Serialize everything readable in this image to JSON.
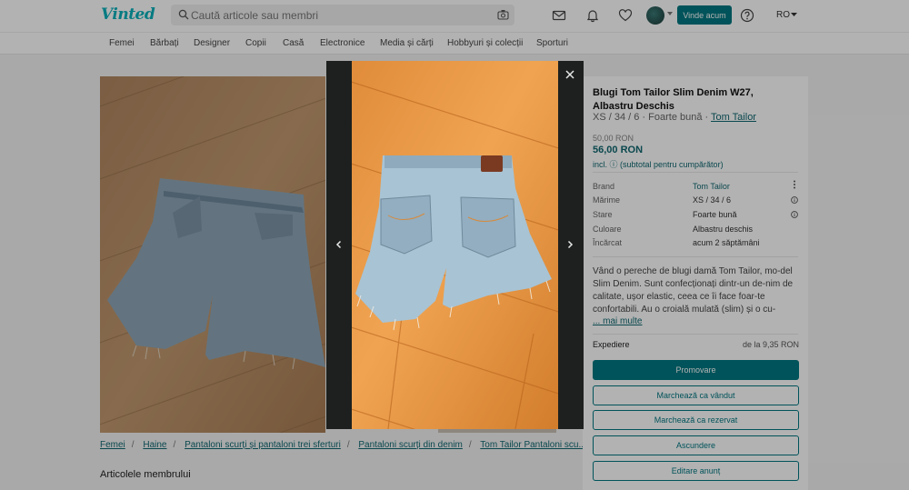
{
  "header": {
    "logo": "Vinted",
    "search_placeholder": "Caută articole sau membri",
    "sell_label": "Vinde acum",
    "lang": "RO"
  },
  "categories": [
    "Femei",
    "Bărbați",
    "Designer",
    "Copii",
    "Casă",
    "Electronice",
    "Media și cărți",
    "Hobbyuri și colecții",
    "Sporturi"
  ],
  "item": {
    "title": "Blugi Tom Tailor Slim Denim W27, Albastru Deschis",
    "sub_sizes": "XS / 34 / 6 · Foarte bună · ",
    "sub_brand": "Tom Tailor",
    "price_old": "50,00 RON",
    "price_new": "56,00 RON",
    "price_incl": "incl. ⓘ (subtotal pentru cumpărător)",
    "details": [
      {
        "label": "Brand",
        "value": "Tom Tailor"
      },
      {
        "label": "Mărime",
        "value": "XS / 34 / 6"
      },
      {
        "label": "Stare",
        "value": "Foarte bună"
      },
      {
        "label": "Culoare",
        "value": "Albastru deschis"
      },
      {
        "label": "Încărcat",
        "value": "acum 2 săptămâni"
      }
    ],
    "description": "Vând o pereche de blugi damă Tom Tailor, mo-del Slim Denim. Sunt confecționați dintr-un de-nim de calitate, ușor elastic, ceea ce îi face foar-te confortabili. Au o croială mulată (slim) și o cu-",
    "more": "... mai multe",
    "shipping_label": "Expediere",
    "shipping_value": "de la 9,35 RON"
  },
  "buttons": {
    "promote": "Promovare",
    "mark_sold": "Marchează ca vândut",
    "mark_reserved": "Marchează ca rezervat",
    "hide": "Ascundere",
    "edit": "Editare anunț"
  },
  "breadcrumbs": [
    "Femei",
    "Haine",
    "Pantaloni scurți și pantaloni trei sferturi",
    "Pantaloni scurți din denim",
    "Tom Tailor Pantaloni scu..."
  ],
  "members_title": "Articolele membrului",
  "colors": {
    "accent": "#007782",
    "logo": "#09b1ba"
  },
  "icons": [
    "search-icon",
    "camera-icon",
    "mail-icon",
    "bell-icon",
    "heart-icon",
    "help-icon",
    "close-icon",
    "chevron-left-icon",
    "chevron-right-icon",
    "info-icon",
    "kebab-icon"
  ]
}
